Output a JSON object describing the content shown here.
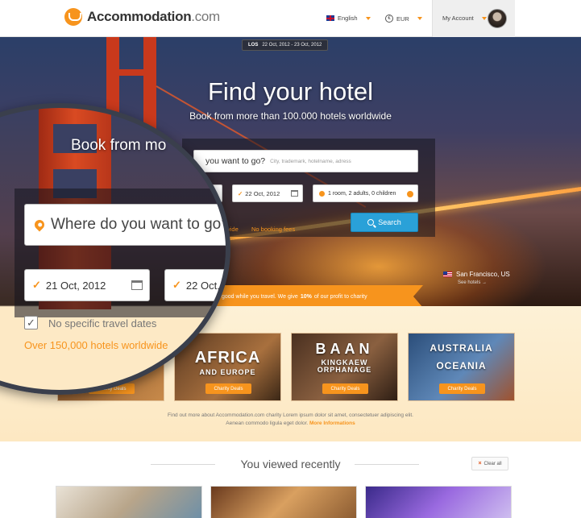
{
  "header": {
    "logo": {
      "brand": "Accommodation",
      "domain": ".com"
    },
    "language": "English",
    "currency": "EUR",
    "account": "My Account"
  },
  "hero": {
    "date_pill": {
      "code": "LOS",
      "dates": "22 Oct, 2012 - 23 Oct, 2012"
    },
    "title": "Find your hotel",
    "subtitle": "Book from more than 100.000 hotels worldwide",
    "search": {
      "question": "you want to go?",
      "placeholder": "City, trademark, hotelname, adress",
      "checkin_fragment": "12",
      "checkout": "22 Oct, 2012",
      "guests": "1 room, 2 adults, 0 children",
      "wide_fragment": "vide",
      "no_booking_fees": "No booking fees",
      "search_button": "Search"
    },
    "location": {
      "name": "San Francisco, US",
      "link": "See hotels →"
    },
    "charity_ribbon": {
      "pre": "good while you travel. We give",
      "highlight": "10%",
      "post": "of our profit to charity"
    }
  },
  "magnifier": {
    "book_text": "Book from mo",
    "where": "Where do you want to go?",
    "checkin": "21 Oct, 2012",
    "checkout": "22 Oct, 2",
    "checkbox_mark": "✓",
    "no_specific": "No specific travel dates",
    "over": "Over 150,000 hotels worldwide"
  },
  "charity": {
    "cards": [
      {
        "name": "",
        "sub": "",
        "button": "Charity Deals"
      },
      {
        "name": "AFRICA",
        "sub": "AND EUROPE",
        "button": "Charity Deals"
      },
      {
        "name": "BAAN",
        "sub": "KINGKAEW ORPHANAGE",
        "button": "Charity Deals"
      },
      {
        "name": "AUSTRALIA",
        "sub": "OCEANIA",
        "button": "Charity Deals"
      }
    ],
    "text_line1": "Find out more about Accommodation.com charity Lorem ipsum dolor sit amet, consectetuer adipiscing elit.",
    "text_line2": "Aenean commodo ligula eget dolor.",
    "more_link": "More Informations"
  },
  "recent": {
    "title": "You viewed recently",
    "clear": "Clear all"
  },
  "colors": {
    "accent": "#f7941d",
    "search_button": "#2aa1d8"
  }
}
